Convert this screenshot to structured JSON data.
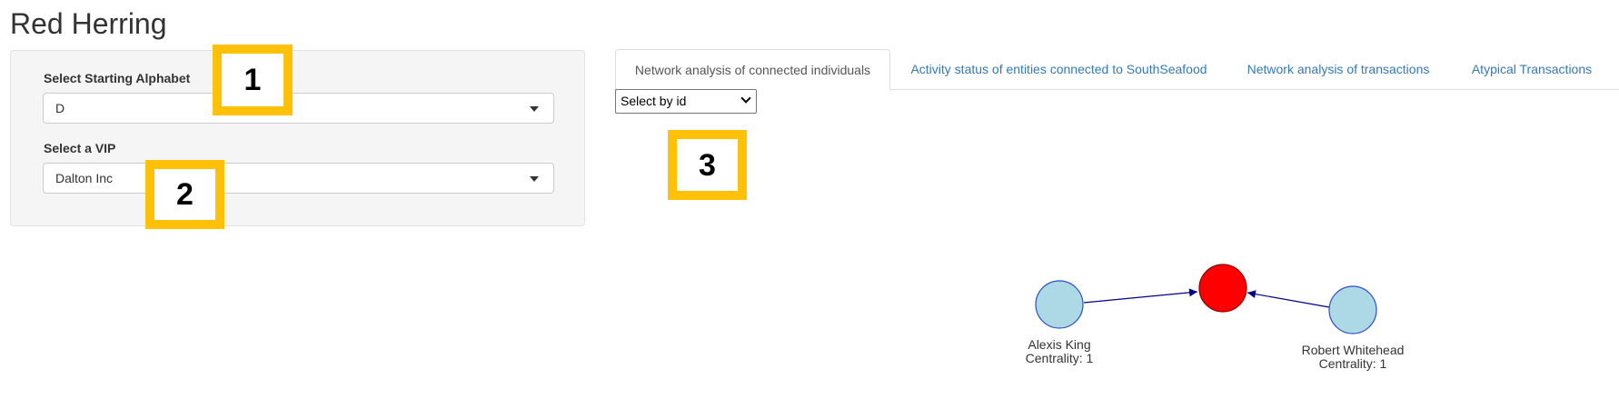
{
  "app": {
    "title": "Red Herring"
  },
  "sidebar": {
    "alphabet": {
      "label": "Select Starting Alphabet",
      "value": "D"
    },
    "vip": {
      "label": "Select a VIP",
      "value": "Dalton Inc"
    }
  },
  "tabs": [
    {
      "label": "Network analysis of connected individuals",
      "active": true
    },
    {
      "label": "Activity status of entities connected to SouthSeafood",
      "active": false
    },
    {
      "label": "Network analysis of transactions",
      "active": false
    },
    {
      "label": "Atypical Transactions",
      "active": false
    }
  ],
  "network": {
    "id_select": {
      "value": "Select by id"
    },
    "nodes": [
      {
        "name": "Alexis King",
        "centrality": "Centrality: 1",
        "color": "#add8e6"
      },
      {
        "name": "",
        "centrality": "",
        "color": "#ff0000"
      },
      {
        "name": "Robert Whitehead",
        "centrality": "Centrality: 1",
        "color": "#add8e6"
      }
    ],
    "edge_color": "#00008b"
  },
  "annotations": [
    "1",
    "2",
    "3"
  ],
  "colors": {
    "annotation_border": "#ffc107",
    "link": "#337ab7"
  }
}
